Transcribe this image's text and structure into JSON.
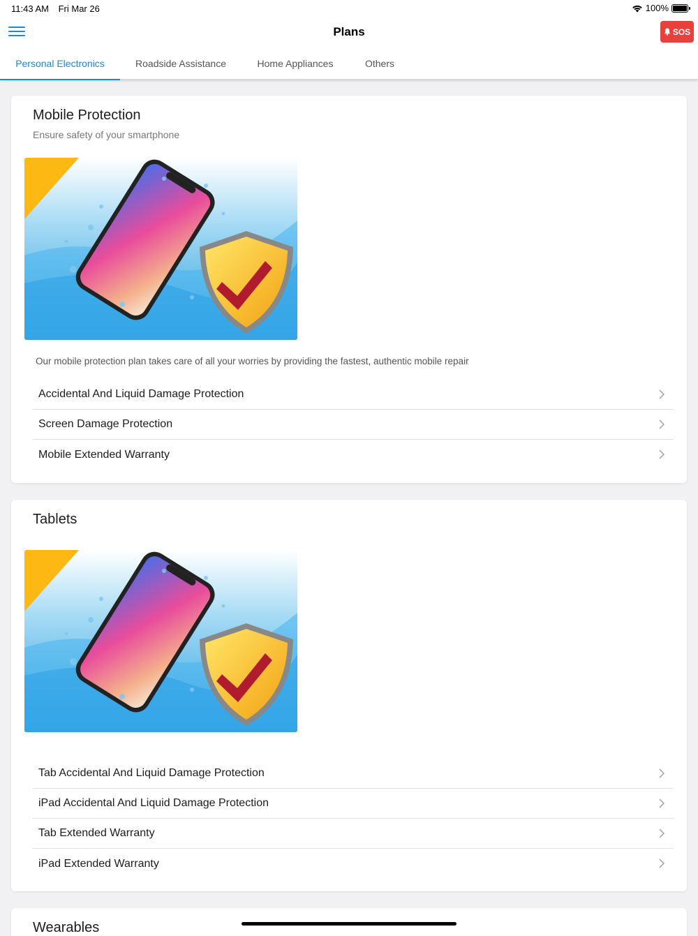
{
  "status_bar": {
    "time": "11:43 AM",
    "date": "Fri Mar 26",
    "battery": "100%"
  },
  "nav": {
    "title": "Plans",
    "sos_label": "SOS"
  },
  "tabs": [
    {
      "label": "Personal Electronics",
      "active": true
    },
    {
      "label": "Roadside Assistance",
      "active": false
    },
    {
      "label": "Home Appliances",
      "active": false
    },
    {
      "label": "Others",
      "active": false
    }
  ],
  "cards": [
    {
      "title": "Mobile Protection",
      "subtitle": "Ensure safety of your smartphone",
      "description": "Our mobile protection plan takes care of all your worries by providing the fastest, authentic mobile repair",
      "plans": [
        "Accidental And Liquid Damage Protection",
        "Screen Damage Protection",
        "Mobile Extended Warranty"
      ]
    },
    {
      "title": "Tablets",
      "plans": [
        "Tab Accidental And Liquid Damage Protection",
        "iPad Accidental And Liquid Damage Protection",
        "Tab Extended Warranty",
        "iPad Extended Warranty"
      ]
    },
    {
      "title": "Wearables"
    }
  ],
  "colors": {
    "accent": "#1b8ad6",
    "sos": "#e8403a",
    "background": "#f1f1f3"
  }
}
